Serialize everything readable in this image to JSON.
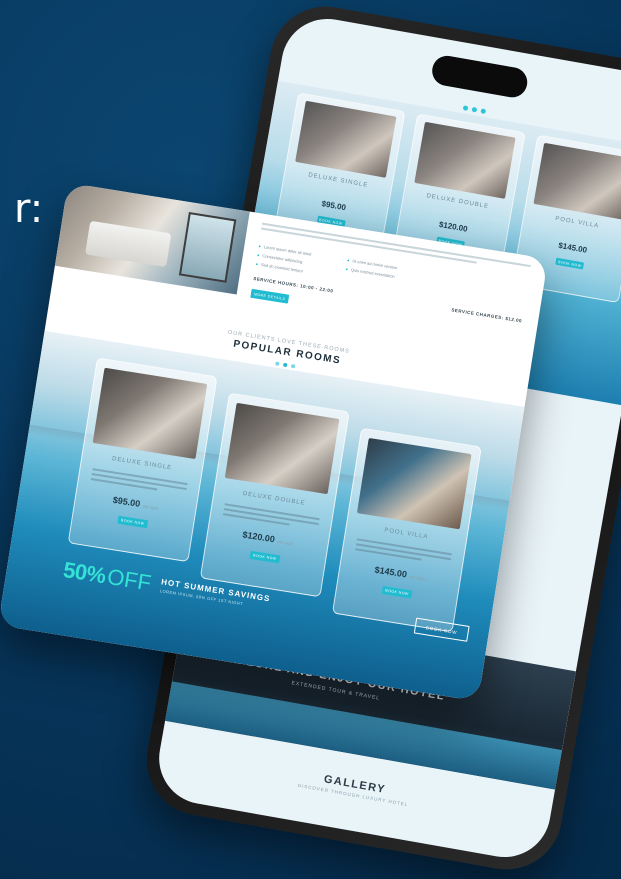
{
  "edge_text": "r:",
  "phone": {
    "rooms": [
      {
        "name": "DELUXE SINGLE",
        "price": "$95.00",
        "button": "BOOK NOW"
      },
      {
        "name": "DELUXE DOUBLE",
        "price": "$120.00",
        "button": "BOOK NOW"
      },
      {
        "name": "POOL VILLA",
        "price": "$145.00",
        "button": "BOOK NOW"
      }
    ],
    "hero_title": "EXPLORE AND ENJOY OUR HOTEL",
    "hero_sub": "EXTENDED TOUR & TRAVEL",
    "gallery_title": "GALLERY",
    "gallery_sub": "DISCOVER THROUGH LUXURY HOTEL"
  },
  "card": {
    "amenities_left": [
      "Lorem ipsum dolor sit amet",
      "Consectetur adipiscing",
      "Sed do eiusmod tempor"
    ],
    "amenities_right": [
      "Ut enim ad minim veniam",
      "Quis nostrud exercitation"
    ],
    "service_hours": "SERVICE HOURS: 10:00 - 22:00",
    "service_charges": "SERVICE CHARGES: $12.00",
    "more_button": "MORE DETAILS",
    "section_kicker": "OUR CLIENTS LOVE THESE ROOMS",
    "section_title": "POPULAR ROOMS",
    "rooms": [
      {
        "name": "DELUXE SINGLE",
        "price": "$95.00",
        "per": "per night",
        "button": "BOOK NOW"
      },
      {
        "name": "DELUXE DOUBLE",
        "price": "$120.00",
        "per": "per night",
        "button": "BOOK NOW"
      },
      {
        "name": "POOL VILLA",
        "price": "$145.00",
        "per": "per night",
        "button": "BOOK NOW"
      }
    ],
    "promo_percent": "50%",
    "promo_off": "OFF",
    "promo_title": "HOT SUMMER SAVINGS",
    "promo_sub": "LOREM IPSUM, 50% OFF 1ST NIGHT",
    "promo_button": "BOOK NOW"
  }
}
